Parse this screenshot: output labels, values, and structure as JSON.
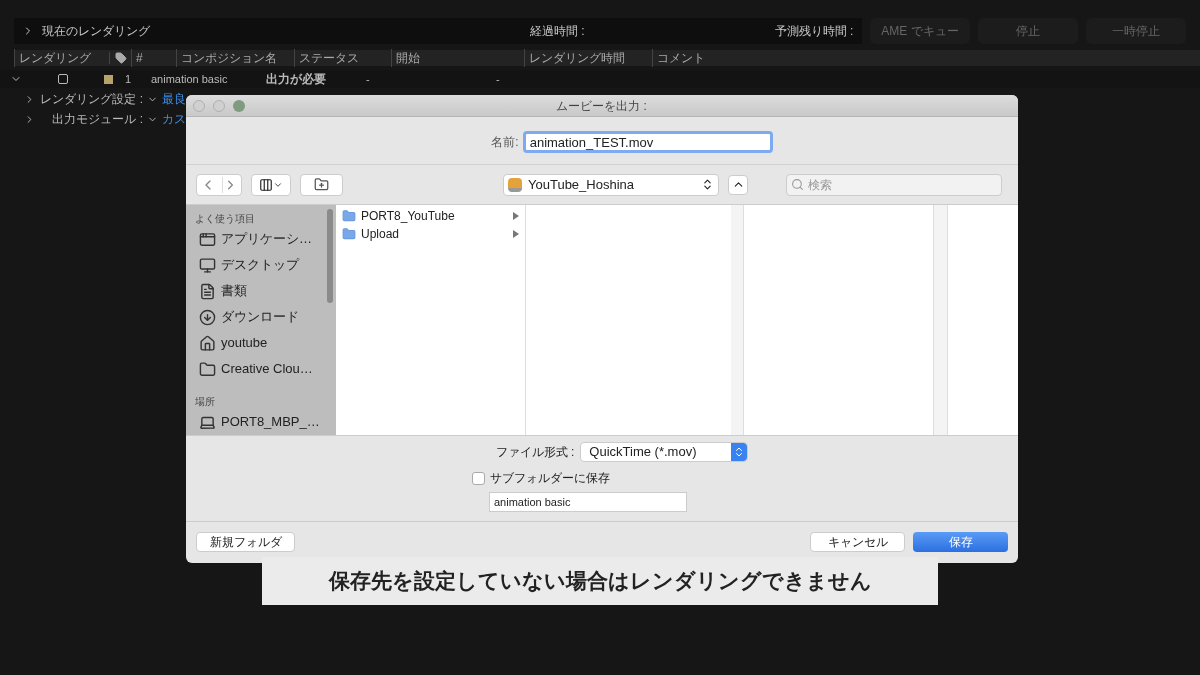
{
  "render_panel": {
    "current_label": "現在のレンダリング",
    "elapsed_label": "経過時間 :",
    "remaining_label": "予測残り時間 :",
    "buttons": [
      {
        "label": "AME でキュー",
        "disabled": true
      },
      {
        "label": "停止",
        "disabled": true
      },
      {
        "label": "一時停止",
        "disabled": true
      }
    ]
  },
  "queue": {
    "columns": [
      "レンダリング",
      "#",
      "コンポジション名",
      "ステータス",
      "開始",
      "レンダリング時間",
      "コメント"
    ],
    "rows": [
      {
        "checked": false,
        "number": "1",
        "name": "animation basic",
        "status": "出力が必要",
        "start": "-",
        "render_time": "-",
        "expanded": true
      }
    ],
    "settings": [
      {
        "label": "レンダリング設定 :",
        "value": "最良"
      },
      {
        "label": "出力モジュール :",
        "value": "カス"
      }
    ]
  },
  "dialog": {
    "title": "ムービーを出力 :",
    "name_label": "名前:",
    "name_value": "animation_TEST.mov",
    "location": "YouTube_Hoshina",
    "search_placeholder": "検索",
    "sidebar": [
      {
        "heading": "よく使う項目",
        "items": [
          {
            "label": "アプリケーシ…",
            "kind": "apps"
          },
          {
            "label": "デスクトップ",
            "kind": "desktop"
          },
          {
            "label": "書類",
            "kind": "docs"
          },
          {
            "label": "ダウンロード",
            "kind": "download"
          },
          {
            "label": "youtube",
            "kind": "home"
          },
          {
            "label": "Creative Clou…",
            "kind": "folder"
          }
        ]
      },
      {
        "heading": "場所",
        "items": [
          {
            "label": "PORT8_MBP_…",
            "kind": "laptop"
          }
        ]
      }
    ],
    "files": [
      {
        "name": "PORT8_YouTube"
      },
      {
        "name": "Upload"
      }
    ],
    "format_label": "ファイル形式 :",
    "format_value": "QuickTime (*.mov)",
    "subfolder_label": "サブフォルダーに保存",
    "subfolder_checked": false,
    "subfolder_name": "animation basic",
    "new_folder": "新規フォルダ",
    "cancel": "キャンセル",
    "save": "保存"
  },
  "caption": "保存先を設定していない場合はレンダリングできません"
}
